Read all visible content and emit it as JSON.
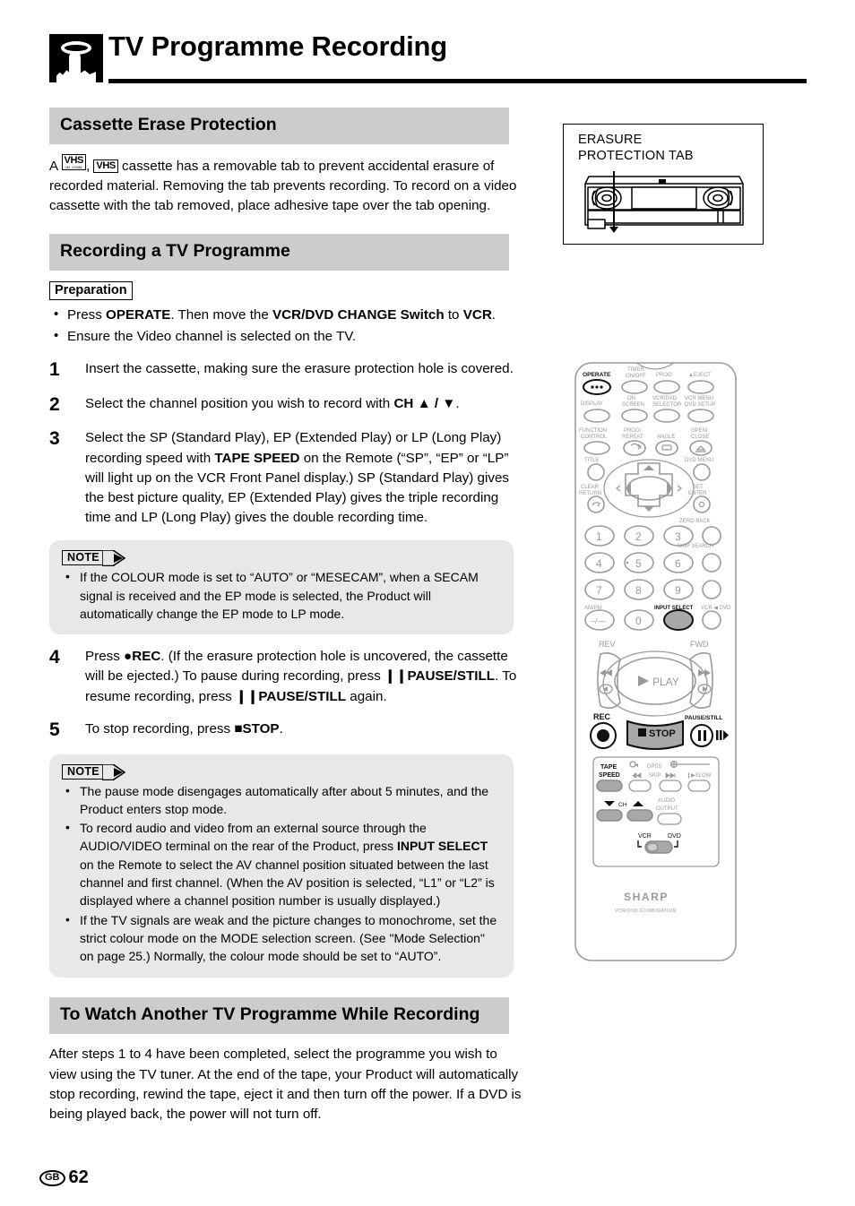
{
  "header": {
    "icon": "hand-pointing-icon",
    "title": "TV Programme Recording"
  },
  "sections": {
    "cassette_erase": {
      "heading": "Cassette Erase Protection",
      "para_before": "A ",
      "logo1": "VHS",
      "logo1_sub": "NO. 123456",
      "logo_sep": ", ",
      "logo2": "VHS",
      "para_after": " cassette has a removable tab to prevent accidental erasure of recorded material. Removing the tab prevents recording. To record on a video cassette with the tab removed, place adhesive tape over the tab opening."
    },
    "recording": {
      "heading": "Recording a TV Programme",
      "preparation_tag": "Preparation",
      "prep_bullets": [
        {
          "pre": "Press ",
          "b1": "OPERATE",
          "mid": ". Then move the ",
          "b2": "VCR/DVD CHANGE Switch",
          "mid2": " to ",
          "b3": "VCR",
          "post": "."
        },
        {
          "pre": "Ensure the Video channel is selected on the TV.",
          "b1": "",
          "mid": "",
          "b2": "",
          "mid2": "",
          "b3": "",
          "post": ""
        }
      ],
      "steps": [
        {
          "num": "1",
          "text": "Insert the cassette, making sure the erasure protection hole is covered."
        },
        {
          "num": "2",
          "text_pre": "Select the channel position you wish to record with ",
          "bold": "CH ▲ / ▼",
          "text_post": "."
        },
        {
          "num": "3",
          "text_pre": "Select the SP (Standard Play), EP (Extended Play) or LP (Long Play) recording speed with ",
          "bold": "TAPE SPEED",
          "text_post": " on the Remote (“SP”, “EP” or “LP” will light up on the VCR Front Panel display.) SP (Standard Play) gives the best picture quality, EP (Extended Play) gives the triple recording time and LP (Long Play) gives the double recording time."
        },
        {
          "num": "4",
          "text_pre": "Press ",
          "bold1": "●REC",
          "text_mid1": ". (If the erasure protection hole is uncovered, the cassette will be ejected.) To pause during recording, press ",
          "bold2": "❙❙PAUSE/STILL",
          "text_mid2": ". To resume recording, press ",
          "bold3": "❙❙PAUSE/STILL",
          "text_post": " again."
        },
        {
          "num": "5",
          "text_pre": "To stop recording, press ",
          "bold": "■STOP",
          "text_post": "."
        }
      ],
      "note1": {
        "tag": "NOTE",
        "items": [
          "If the COLOUR mode is set to “AUTO” or “MESECAM”, when a SECAM signal is received and the EP mode is selected, the Product will automatically change the EP mode to LP mode."
        ]
      },
      "note2": {
        "tag": "NOTE",
        "items": [
          {
            "pre": "The pause mode disengages automatically after about 5 minutes, and the Product enters stop mode.",
            "bold": "",
            "post": ""
          },
          {
            "pre": "To record audio and video from an external source through the AUDIO/VIDEO terminal on the rear of the Product, press ",
            "bold": "INPUT SELECT",
            "post": " on the Remote to select the AV channel position situated between the last channel and first channel. (When the AV position is selected, “L1” or “L2” is displayed where a channel position number is usually displayed.)"
          },
          {
            "pre": "If the TV signals are weak and the picture changes to monochrome, set the strict colour mode on the MODE selection screen. (See \"Mode Selection\" on page 25.) Normally, the colour mode should be set to “AUTO”.",
            "bold": "",
            "post": ""
          }
        ]
      }
    },
    "watch_another": {
      "heading": "To Watch Another TV Programme While Recording",
      "body": "After steps 1 to 4 have been completed, select the programme you wish to view using the TV tuner. At the end of the tape, your Product will automatically stop recording, rewind the tape, eject it and then turn off the power. If a DVD is being played back, the power will not turn off."
    }
  },
  "figures": {
    "cassette": {
      "label_line1": "ERASURE",
      "label_line2": "PROTECTION TAB"
    },
    "remote": {
      "brand": "SHARP",
      "brand_sub": "VCR/DVD COMBINATION",
      "buttons": {
        "operate": "OPERATE",
        "timer_onoff_1": "TIMER",
        "timer_onoff_2": "ON/OFF",
        "prog": "PROG",
        "eject": "▲EJECT",
        "display": "DISPLAY",
        "on_screen_1": "ON",
        "on_screen_2": "SCREEN",
        "vcr_dvd_sel_1": "VCR/DVD",
        "vcr_dvd_sel_2": "SELECTOR",
        "vcr_menu_1": "VCR MENU",
        "vcr_menu_2": "DVD SETUP",
        "function_1": "FUNCTION",
        "function_2": "CONTROL",
        "prog_repeat_1": "PROG/",
        "prog_repeat_2": "REPEAT",
        "angle": "ANGLE",
        "open_close_1": "OPEN/",
        "open_close_2": "CLOSE",
        "title": "TITLE",
        "dvd_menu": "DVD MENU",
        "clear_1": "CLEAR",
        "clear_2": "RETURN",
        "set_1": "SET",
        "set_2": "ENTER",
        "zero_back": "ZERO BACK",
        "skip_search": "SKIP SEARCH",
        "am_pm": "AM/PM",
        "dash": "–/––",
        "input_select": "INPUT SELECT",
        "vcr_dvd_toggle": "VCR ◀ DVD",
        "n1": "1",
        "n2": "2",
        "n3": "3",
        "n4": "4",
        "n5": "5",
        "n6": "6",
        "n7": "7",
        "n8": "8",
        "n9": "9",
        "n0": "0",
        "rev": "REV",
        "fwd": "FWD",
        "play": "PLAY",
        "rec": "REC",
        "stop": "STOP",
        "pause_still": "PAUSE/STILL",
        "tape_speed_1": "TAPE",
        "tape_speed_2": "SPEED",
        "dpss": "DPSS",
        "skip": "SKIP",
        "slow": "❙▶SLOW",
        "ch": "CH",
        "audio_1": "AUDIO",
        "audio_2": "OUTPUT",
        "switch_vcr": "VCR",
        "switch_dvd": "DVD"
      },
      "highlighted": [
        "input-select",
        "rec",
        "stop",
        "pause-still",
        "tape-speed",
        "ch-down",
        "ch-up",
        "vcr-dvd-switch"
      ]
    }
  },
  "footer": {
    "region": "GB",
    "page": "62"
  }
}
